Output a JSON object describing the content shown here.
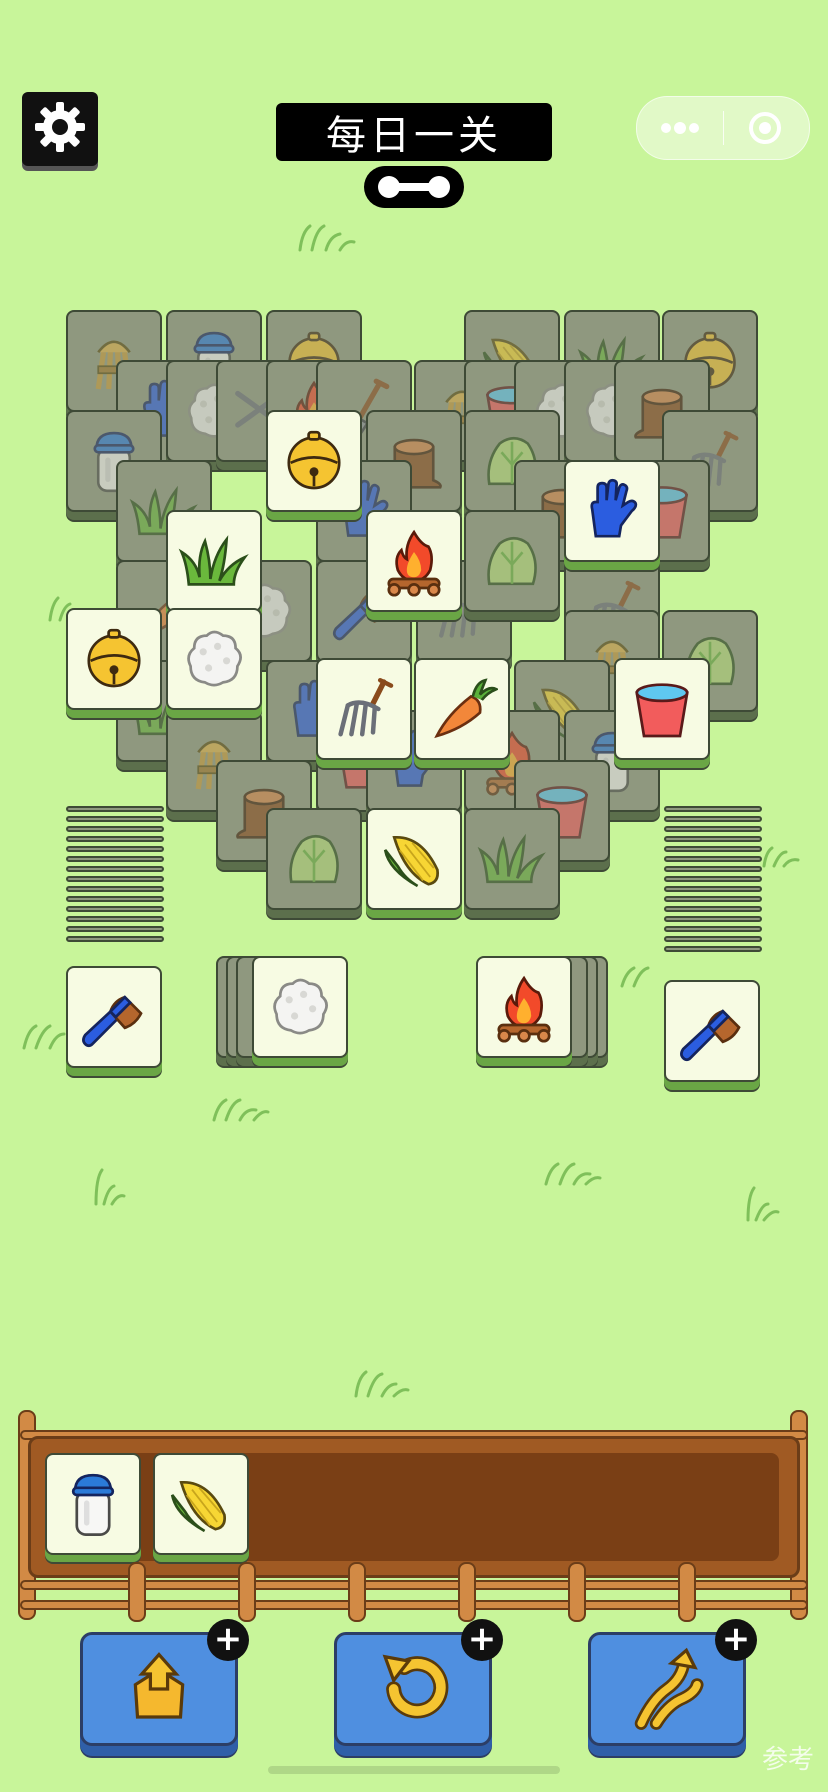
{
  "header": {
    "title": "每日一关",
    "settings_icon": "gear-icon",
    "progress_icon": "progress-pill-icon",
    "capsule_more_icon": "more-dots-icon",
    "capsule_close_icon": "target-circle-icon"
  },
  "board": {
    "tiles": [
      {
        "item": "wheat",
        "state": "covered"
      },
      {
        "item": "milk-jar",
        "state": "covered"
      },
      {
        "item": "bell",
        "state": "covered"
      },
      {
        "item": "corn",
        "state": "covered"
      },
      {
        "item": "grass",
        "state": "covered"
      },
      {
        "item": "bell",
        "state": "covered"
      },
      {
        "item": "glove",
        "state": "covered"
      },
      {
        "item": "rice",
        "state": "covered"
      },
      {
        "item": "scissors",
        "state": "covered"
      },
      {
        "item": "fire",
        "state": "covered"
      },
      {
        "item": "shovel",
        "state": "covered"
      },
      {
        "item": "wheat",
        "state": "covered"
      },
      {
        "item": "bucket",
        "state": "covered"
      },
      {
        "item": "rice",
        "state": "covered"
      },
      {
        "item": "rice",
        "state": "covered"
      },
      {
        "item": "stump",
        "state": "covered"
      },
      {
        "item": "milk-jar",
        "state": "covered"
      },
      {
        "item": "cabbage",
        "state": "covered"
      },
      {
        "item": "stump",
        "state": "covered"
      },
      {
        "item": "fork",
        "state": "covered"
      },
      {
        "item": "bell",
        "state": "open"
      },
      {
        "item": "glove",
        "state": "open"
      },
      {
        "item": "grass",
        "state": "open"
      },
      {
        "item": "fire",
        "state": "open"
      },
      {
        "item": "bell",
        "state": "open"
      },
      {
        "item": "rice",
        "state": "open"
      },
      {
        "item": "fork",
        "state": "open"
      },
      {
        "item": "carrot",
        "state": "open"
      },
      {
        "item": "bucket",
        "state": "open"
      },
      {
        "item": "wheat",
        "state": "covered"
      },
      {
        "item": "cabbage",
        "state": "covered"
      },
      {
        "item": "wheat",
        "state": "covered"
      },
      {
        "item": "stump",
        "state": "covered"
      },
      {
        "item": "milk-jar",
        "state": "covered"
      },
      {
        "item": "bucket",
        "state": "covered"
      },
      {
        "item": "cabbage",
        "state": "covered"
      },
      {
        "item": "corn",
        "state": "open"
      },
      {
        "item": "grass",
        "state": "covered"
      }
    ]
  },
  "side_stacks": [
    {
      "position": "left",
      "top_item": "brush"
    },
    {
      "position": "center-left",
      "top_item": "rice"
    },
    {
      "position": "center-right",
      "top_item": "fire"
    },
    {
      "position": "right",
      "top_item": "brush"
    }
  ],
  "tray": {
    "capacity": 7,
    "slots": [
      {
        "item": "milk-jar"
      },
      {
        "item": "corn"
      }
    ]
  },
  "powerups": [
    {
      "name": "move-out",
      "icon": "move-out-icon",
      "plus": "+"
    },
    {
      "name": "undo",
      "icon": "undo-icon",
      "plus": "+"
    },
    {
      "name": "shuffle",
      "icon": "shuffle-icon",
      "plus": "+"
    }
  ],
  "watermark": "参考"
}
